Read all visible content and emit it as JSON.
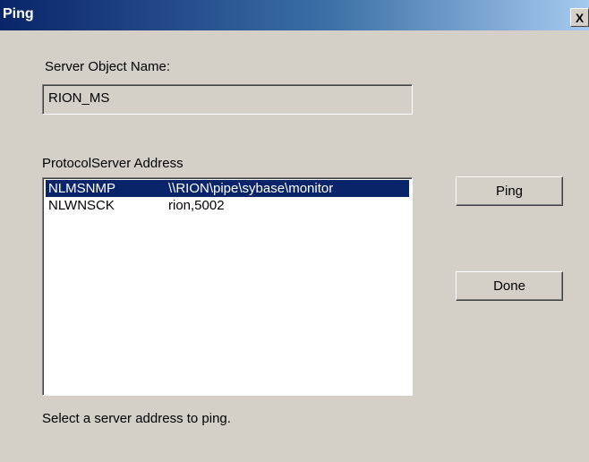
{
  "window": {
    "title": "Ping",
    "close_glyph": "X"
  },
  "server_object": {
    "label": "Server Object Name:",
    "value": "RION_MS"
  },
  "address_list": {
    "header": "ProtocolServer Address",
    "rows": [
      {
        "protocol": "NLMSNMP",
        "address": "\\\\RION\\pipe\\sybase\\monitor",
        "selected": true
      },
      {
        "protocol": "NLWNSCK",
        "address": "rion,5002",
        "selected": false
      }
    ]
  },
  "buttons": {
    "ping": "Ping",
    "done": "Done"
  },
  "status": "Select a server address to ping.",
  "colors": {
    "dialog_bg": "#d4d0c8",
    "title_start": "#0a246a",
    "title_end": "#a6caf0",
    "selection_bg": "#0a246a"
  }
}
